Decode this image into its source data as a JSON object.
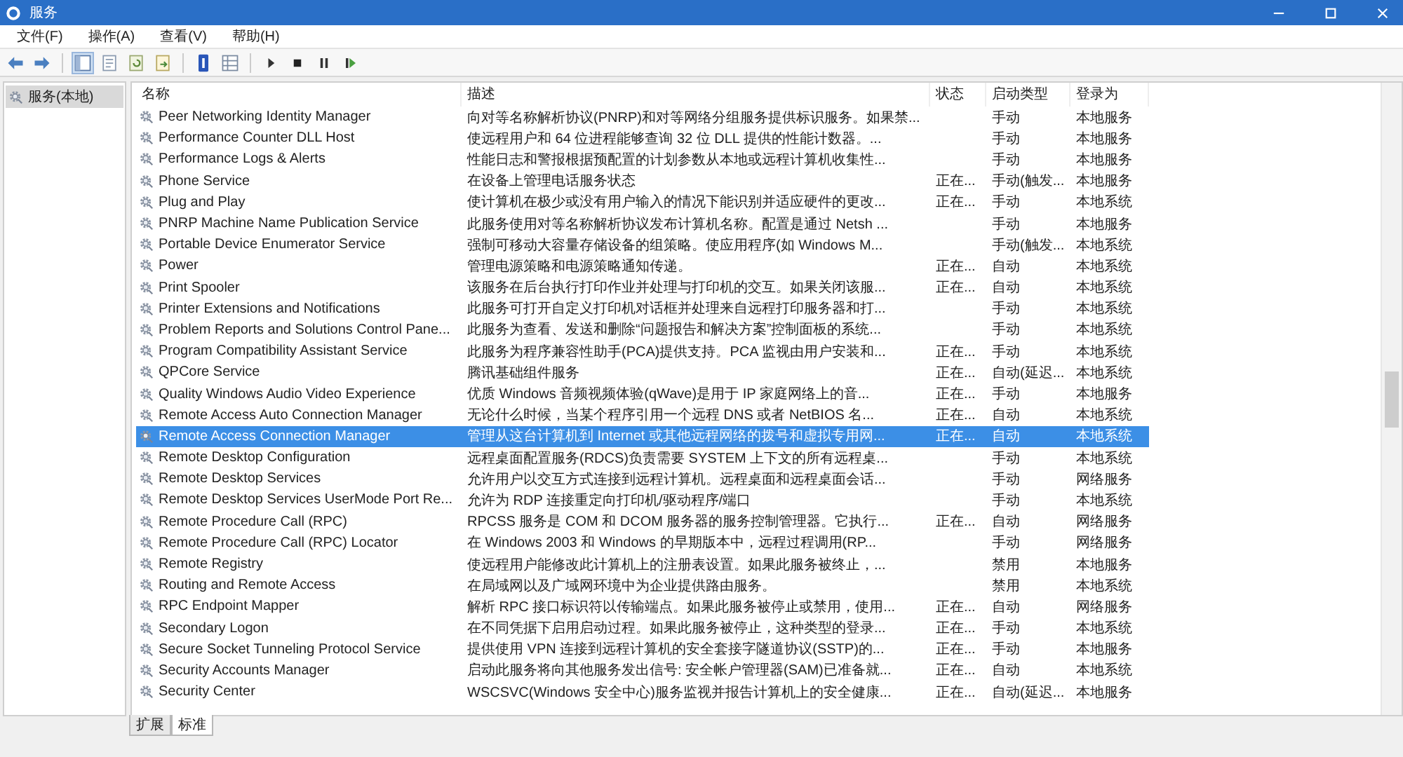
{
  "window": {
    "title": "服务"
  },
  "menu": [
    "文件(F)",
    "操作(A)",
    "查看(V)",
    "帮助(H)"
  ],
  "tree": {
    "items": [
      {
        "label": "服务(本地)",
        "selected": true
      }
    ]
  },
  "table": {
    "columns": [
      "名称",
      "描述",
      "状态",
      "启动类型",
      "登录为"
    ],
    "rows": [
      {
        "name": "Peer Networking Identity Manager",
        "description": "向对等名称解析协议(PNRP)和对等网络分组服务提供标识服务。如果禁...",
        "startup_type": "手动",
        "log_on_as": "本地服务",
        "selected": false
      },
      {
        "name": "Performance Counter DLL Host",
        "description": "使远程用户和 64 位进程能够查询 32 位 DLL 提供的性能计数器。...",
        "startup_type": "手动",
        "log_on_as": "本地服务",
        "selected": false
      },
      {
        "name": "Performance Logs & Alerts",
        "description": "性能日志和警报根据预配置的计划参数从本地或远程计算机收集性...",
        "startup_type": "手动",
        "log_on_as": "本地服务",
        "selected": false
      },
      {
        "name": "Phone Service",
        "description": "在设备上管理电话服务状态",
        "status": "正在...",
        "startup_type": "手动(触发...",
        "log_on_as": "本地服务",
        "selected": false
      },
      {
        "name": "Plug and Play",
        "description": "使计算机在极少或没有用户输入的情况下能识别并适应硬件的更改...",
        "status": "正在...",
        "startup_type": "手动",
        "log_on_as": "本地系统",
        "selected": false
      },
      {
        "name": "PNRP Machine Name Publication Service",
        "description": "此服务使用对等名称解析协议发布计算机名称。配置是通过 Netsh ...",
        "startup_type": "手动",
        "log_on_as": "本地服务",
        "selected": false
      },
      {
        "name": "Portable Device Enumerator Service",
        "description": "强制可移动大容量存储设备的组策略。使应用程序(如 Windows M...",
        "startup_type": "手动(触发...",
        "log_on_as": "本地系统",
        "selected": false
      },
      {
        "name": "Power",
        "description": "管理电源策略和电源策略通知传递。",
        "status": "正在...",
        "startup_type": "自动",
        "log_on_as": "本地系统",
        "selected": false
      },
      {
        "name": "Print Spooler",
        "description": "该服务在后台执行打印作业并处理与打印机的交互。如果关闭该服...",
        "status": "正在...",
        "startup_type": "自动",
        "log_on_as": "本地系统",
        "selected": false
      },
      {
        "name": "Printer Extensions and Notifications",
        "description": "此服务可打开自定义打印机对话框并处理来自远程打印服务器和打...",
        "startup_type": "手动",
        "log_on_as": "本地系统",
        "selected": false
      },
      {
        "name": "Problem Reports and Solutions Control Pane...",
        "description": "此服务为查看、发送和删除“问题报告和解决方案”控制面板的系统...",
        "startup_type": "手动",
        "log_on_as": "本地系统",
        "selected": false
      },
      {
        "name": "Program Compatibility Assistant Service",
        "description": "此服务为程序兼容性助手(PCA)提供支持。PCA 监视由用户安装和...",
        "status": "正在...",
        "startup_type": "手动",
        "log_on_as": "本地系统",
        "selected": false
      },
      {
        "name": "QPCore Service",
        "description": "腾讯基础组件服务",
        "status": "正在...",
        "startup_type": "自动(延迟...",
        "log_on_as": "本地系统",
        "selected": false
      },
      {
        "name": "Quality Windows Audio Video Experience",
        "description": "优质 Windows 音频视频体验(qWave)是用于 IP 家庭网络上的音...",
        "status": "正在...",
        "startup_type": "手动",
        "log_on_as": "本地服务",
        "selected": false
      },
      {
        "name": "Remote Access Auto Connection Manager",
        "description": "无论什么时候，当某个程序引用一个远程 DNS 或者 NetBIOS 名...",
        "status": "正在...",
        "startup_type": "自动",
        "log_on_as": "本地系统",
        "selected": false
      },
      {
        "name": "Remote Access Connection Manager",
        "description": "管理从这台计算机到 Internet 或其他远程网络的拨号和虚拟专用网...",
        "status": "正在...",
        "startup_type": "自动",
        "log_on_as": "本地系统",
        "selected": true
      },
      {
        "name": "Remote Desktop Configuration",
        "description": "远程桌面配置服务(RDCS)负责需要 SYSTEM 上下文的所有远程桌...",
        "startup_type": "手动",
        "log_on_as": "本地系统",
        "selected": false
      },
      {
        "name": "Remote Desktop Services",
        "description": "允许用户以交互方式连接到远程计算机。远程桌面和远程桌面会话...",
        "startup_type": "手动",
        "log_on_as": "网络服务",
        "selected": false
      },
      {
        "name": "Remote Desktop Services UserMode Port Re...",
        "description": "允许为 RDP 连接重定向打印机/驱动程序/端口",
        "startup_type": "手动",
        "log_on_as": "本地系统",
        "selected": false
      },
      {
        "name": "Remote Procedure Call (RPC)",
        "description": "RPCSS 服务是 COM 和 DCOM 服务器的服务控制管理器。它执行...",
        "status": "正在...",
        "startup_type": "自动",
        "log_on_as": "网络服务",
        "selected": false
      },
      {
        "name": "Remote Procedure Call (RPC) Locator",
        "description": "在 Windows 2003 和 Windows 的早期版本中，远程过程调用(RP...",
        "startup_type": "手动",
        "log_on_as": "网络服务",
        "selected": false
      },
      {
        "name": "Remote Registry",
        "description": "使远程用户能修改此计算机上的注册表设置。如果此服务被终止，...",
        "startup_type": "禁用",
        "log_on_as": "本地服务",
        "selected": false
      },
      {
        "name": "Routing and Remote Access",
        "description": "在局域网以及广域网环境中为企业提供路由服务。",
        "startup_type": "禁用",
        "log_on_as": "本地系统",
        "selected": false
      },
      {
        "name": "RPC Endpoint Mapper",
        "description": "解析 RPC 接口标识符以传输端点。如果此服务被停止或禁用，使用...",
        "status": "正在...",
        "startup_type": "自动",
        "log_on_as": "网络服务",
        "selected": false
      },
      {
        "name": "Secondary Logon",
        "description": "在不同凭据下启用启动过程。如果此服务被停止，这种类型的登录...",
        "status": "正在...",
        "startup_type": "手动",
        "log_on_as": "本地系统",
        "selected": false
      },
      {
        "name": "Secure Socket Tunneling Protocol Service",
        "description": "提供使用 VPN 连接到远程计算机的安全套接字隧道协议(SSTP)的...",
        "status": "正在...",
        "startup_type": "手动",
        "log_on_as": "本地服务",
        "selected": false
      },
      {
        "name": "Security Accounts Manager",
        "description": "启动此服务将向其他服务发出信号: 安全帐户管理器(SAM)已准备就...",
        "status": "正在...",
        "startup_type": "自动",
        "log_on_as": "本地系统",
        "selected": false
      },
      {
        "name": "Security Center",
        "description": "WSCSVC(Windows 安全中心)服务监视并报告计算机上的安全健康...",
        "status": "正在...",
        "startup_type": "自动(延迟...",
        "log_on_as": "本地服务",
        "selected": false
      }
    ]
  },
  "view_tabs": [
    {
      "label": "扩展",
      "selected": false
    },
    {
      "label": "标准",
      "selected": true
    }
  ]
}
